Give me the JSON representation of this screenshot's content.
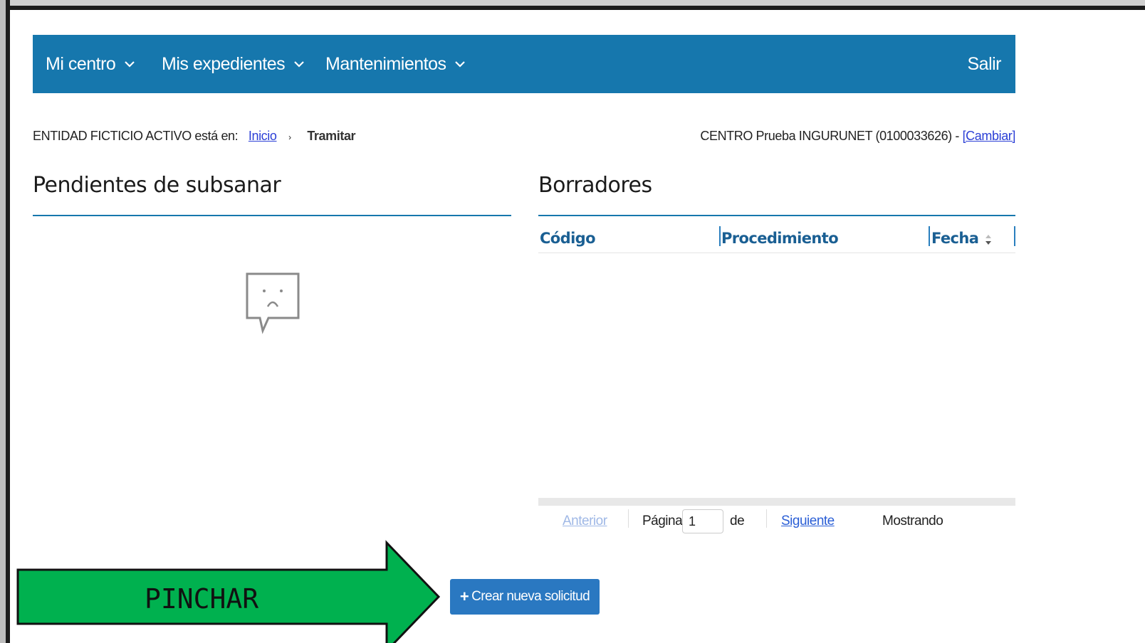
{
  "nav": {
    "items": [
      {
        "label": "Mi centro"
      },
      {
        "label": "Mis expedientes"
      },
      {
        "label": "Mantenimientos"
      }
    ],
    "logout_label": "Salir",
    "color": "#1677ad"
  },
  "breadcrumb": {
    "prefix": "ENTIDAD FICTICIO ACTIVO está en:",
    "home_link": "Inicio",
    "current": "Tramitar"
  },
  "center": {
    "text": "CENTRO Prueba INGURUNET (0100033626) -",
    "change_link": "[Cambiar]"
  },
  "pending_panel": {
    "title": "Pendientes de subsanar",
    "empty_icon": "sad-speech-bubble-icon"
  },
  "drafts_panel": {
    "title": "Borradores",
    "columns": [
      "Código",
      "Procedimiento",
      "Fecha"
    ]
  },
  "pager": {
    "prev_label": "Anterior",
    "page_label": "Página",
    "page_value": "1",
    "of_label": "de",
    "next_label": "Siguiente",
    "showing_label": "Mostrando"
  },
  "create_button": {
    "label": "Crear nueva solicitud",
    "icon": "plus-icon",
    "color": "#2a78c1"
  },
  "annotation": {
    "label": "PINCHAR",
    "color": "#00b14f"
  }
}
